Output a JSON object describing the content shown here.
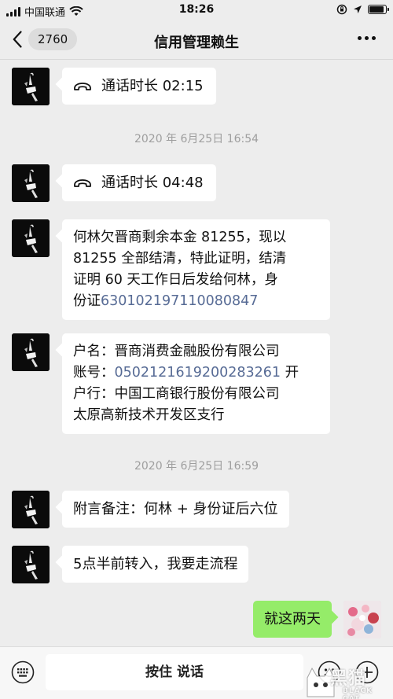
{
  "status_bar": {
    "carrier": "中国联通",
    "time": "18:26",
    "battery_level": 0.9
  },
  "nav": {
    "unread_count": "2760",
    "title": "信用管理赖生"
  },
  "messages": [
    {
      "call_label": "通话时长 02:15"
    },
    {
      "timestamp": "2020 年 6月25日 16:54"
    },
    {
      "call_label": "通话时长 04:48"
    },
    {
      "text_lines": [
        "何林欠晋商剩余本金 81255，现以",
        "81255 全部结清，特此证明，结清",
        "证明 60 天工作日后发给何林，身"
      ],
      "text_prefix": "份证",
      "text_link": "630102197110080847"
    },
    {
      "line1": "户名：晋商消费金融股份有限公司",
      "line2_prefix": " 账号：",
      "line2_link": "050212161920028326​1",
      "line2_suffix": " 开",
      "line3": "户行：中国工商银行股份有限公司",
      "line4": "太原高新技术开发区支行"
    },
    {
      "timestamp": "2020 年 6月25日 16:59"
    },
    {
      "text": "附言备注：何林 + 身份证后六位"
    },
    {
      "text": "5点半前转入，我要走流程"
    },
    {
      "my_text": "就这两天"
    }
  ],
  "input_bar": {
    "hold_to_talk": "按住 说话"
  },
  "watermark": {
    "cn": "黑猫",
    "en": "BLACK CAT"
  }
}
